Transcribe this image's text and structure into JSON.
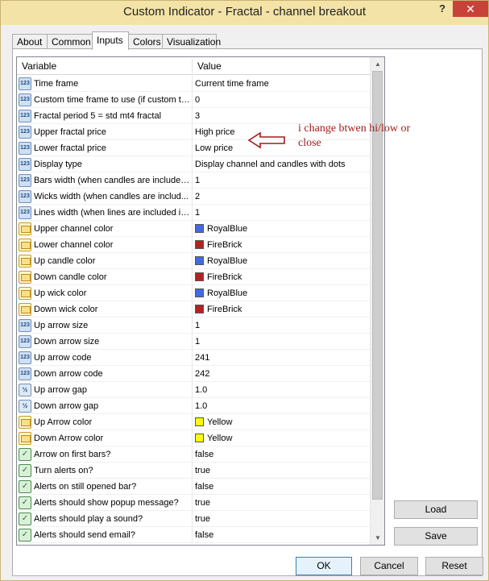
{
  "window": {
    "title": "Custom Indicator - Fractal - channel breakout",
    "help_label": "?",
    "close_label": "✕"
  },
  "tabs": [
    {
      "label": "About"
    },
    {
      "label": "Common"
    },
    {
      "label": "Inputs"
    },
    {
      "label": "Colors"
    },
    {
      "label": "Visualization"
    }
  ],
  "grid": {
    "header_variable": "Variable",
    "header_value": "Value",
    "rows": [
      {
        "name": "Time frame",
        "value": "Current time frame",
        "icon": "num"
      },
      {
        "name": "Custom time frame to use (if custom tim...",
        "value": "0",
        "icon": "num"
      },
      {
        "name": "Fractal period 5 = std mt4 fractal",
        "value": "3",
        "icon": "num"
      },
      {
        "name": "Upper fractal price",
        "value": "High price",
        "icon": "num"
      },
      {
        "name": "Lower fractal price",
        "value": "Low price",
        "icon": "num"
      },
      {
        "name": "Display type",
        "value": "Display channel and candles with dots",
        "icon": "num"
      },
      {
        "name": "Bars width (when candles are included...",
        "value": "1",
        "icon": "num"
      },
      {
        "name": "Wicks width (when candles are includ...",
        "value": "2",
        "icon": "num"
      },
      {
        "name": "Lines width (when lines are included in ...",
        "value": "1",
        "icon": "num"
      },
      {
        "name": "Upper channel color",
        "value": "RoyalBlue",
        "icon": "clr",
        "swatch": "#4169e1"
      },
      {
        "name": "Lower channel color",
        "value": "FireBrick",
        "icon": "clr",
        "swatch": "#b22222"
      },
      {
        "name": "Up candle color",
        "value": "RoyalBlue",
        "icon": "clr",
        "swatch": "#4169e1"
      },
      {
        "name": "Down candle color",
        "value": "FireBrick",
        "icon": "clr",
        "swatch": "#b22222"
      },
      {
        "name": "Up wick color",
        "value": "RoyalBlue",
        "icon": "clr",
        "swatch": "#4169e1"
      },
      {
        "name": "Down wick color",
        "value": "FireBrick",
        "icon": "clr",
        "swatch": "#b22222"
      },
      {
        "name": "Up arrow size",
        "value": "1",
        "icon": "num"
      },
      {
        "name": "Down arrow size",
        "value": "1",
        "icon": "num"
      },
      {
        "name": "Up arrow code",
        "value": "241",
        "icon": "num"
      },
      {
        "name": "Down arrow code",
        "value": "242",
        "icon": "num"
      },
      {
        "name": "Up arrow gap",
        "value": "1.0",
        "icon": "dbl"
      },
      {
        "name": "Down arrow gap",
        "value": "1.0",
        "icon": "dbl"
      },
      {
        "name": "Up Arrow color",
        "value": "Yellow",
        "icon": "clr",
        "swatch": "#ffff00"
      },
      {
        "name": "Down Arrow color",
        "value": "Yellow",
        "icon": "clr",
        "swatch": "#ffff00"
      },
      {
        "name": "Arrow on first bars?",
        "value": "false",
        "icon": "bool"
      },
      {
        "name": "Turn alerts on?",
        "value": "true",
        "icon": "bool"
      },
      {
        "name": "Alerts on still opened bar?",
        "value": "false",
        "icon": "bool"
      },
      {
        "name": "Alerts should show popup message?",
        "value": "true",
        "icon": "bool"
      },
      {
        "name": "Alerts should play a sound?",
        "value": "true",
        "icon": "bool"
      },
      {
        "name": "Alerts should send email?",
        "value": "false",
        "icon": "bool"
      }
    ]
  },
  "side_buttons": {
    "load": "Load",
    "save": "Save"
  },
  "footer": {
    "ok": "OK",
    "cancel": "Cancel",
    "reset": "Reset"
  },
  "annotation": {
    "text": "i change btwen hi/low or close",
    "color": "#a41b1b"
  },
  "colors": {
    "accent": "#3c7fb1",
    "titlebar": "#f3e3a6",
    "close": "#c7433a"
  }
}
